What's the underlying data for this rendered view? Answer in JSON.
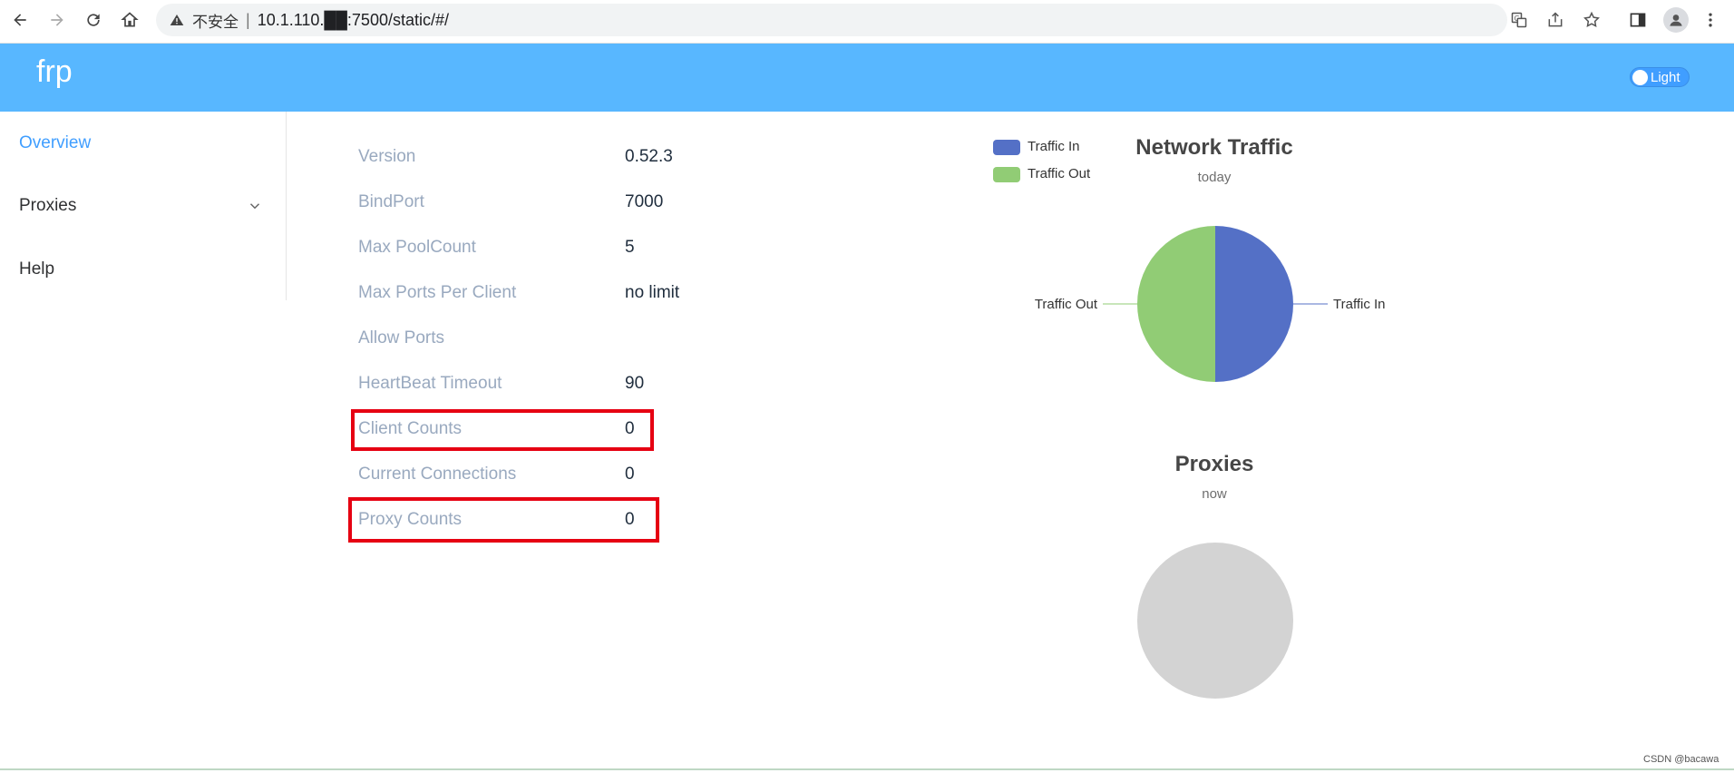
{
  "browser": {
    "security_label": "不安全",
    "url": "10.1.110.██:7500/static/#/"
  },
  "header": {
    "brand": "frp",
    "theme_label": "Light"
  },
  "sidebar": {
    "items": [
      {
        "label": "Overview",
        "active": true
      },
      {
        "label": "Proxies",
        "active": false
      },
      {
        "label": "Help",
        "active": false
      }
    ]
  },
  "server_info": [
    {
      "label": "Version",
      "value": "0.52.3"
    },
    {
      "label": "BindPort",
      "value": "7000"
    },
    {
      "label": "Max PoolCount",
      "value": "5"
    },
    {
      "label": "Max Ports Per Client",
      "value": "no limit"
    },
    {
      "label": "Allow Ports",
      "value": ""
    },
    {
      "label": "HeartBeat Timeout",
      "value": "90"
    },
    {
      "label": "Client Counts",
      "value": "0"
    },
    {
      "label": "Current Connections",
      "value": "0"
    },
    {
      "label": "Proxy Counts",
      "value": "0"
    }
  ],
  "chart_data": [
    {
      "type": "pie",
      "title": "Network Traffic",
      "subtitle": "today",
      "legend": [
        "Traffic In",
        "Traffic Out"
      ],
      "legend_placement": "top-left",
      "series": [
        {
          "name": "Traffic In",
          "value": 50,
          "color": "#5470c6"
        },
        {
          "name": "Traffic Out",
          "value": 50,
          "color": "#91cc75"
        }
      ]
    },
    {
      "type": "pie",
      "title": "Proxies",
      "subtitle": "now",
      "series": [],
      "empty_color": "#d3d3d3"
    }
  ],
  "watermark": "CSDN @bacawa"
}
